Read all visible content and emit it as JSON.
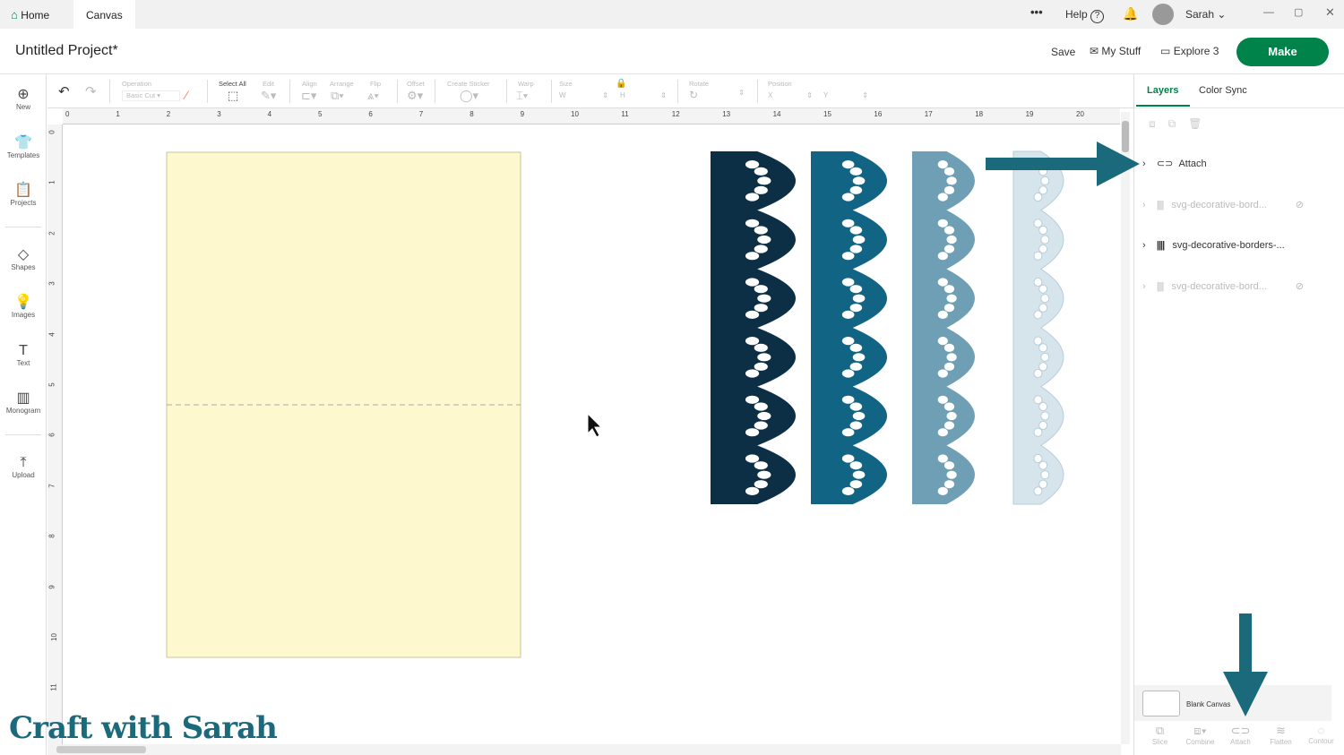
{
  "tabs": [
    {
      "label": "Home",
      "active": false
    },
    {
      "label": "Canvas",
      "active": true
    }
  ],
  "topbar": {
    "more": "•••",
    "help": "Help",
    "user": "Sarah"
  },
  "header": {
    "title": "Untitled Project*",
    "save": "Save",
    "my_stuff": "My Stuff",
    "explore": "Explore 3",
    "make": "Make"
  },
  "sidebar": [
    {
      "label": "New",
      "icon": "⊕"
    },
    {
      "label": "Templates",
      "icon": "👕"
    },
    {
      "label": "Projects",
      "icon": "📋"
    },
    {
      "label": "Shapes",
      "icon": "◇"
    },
    {
      "label": "Images",
      "icon": "💡"
    },
    {
      "label": "Text",
      "icon": "T"
    },
    {
      "label": "Monogram",
      "icon": "▥"
    },
    {
      "label": "Upload",
      "icon": "⤒"
    }
  ],
  "toolbar": {
    "operation": "Operation",
    "operation_value": "Basic Cut",
    "select_all": "Select All",
    "edit": "Edit",
    "align": "Align",
    "arrange": "Arrange",
    "flip": "Flip",
    "offset": "Offset",
    "create_sticker": "Create Sticker",
    "warp": "Warp",
    "size": "Size",
    "w": "W",
    "h": "H",
    "rotate": "Rotate",
    "position": "Position",
    "x": "X",
    "y": "Y"
  },
  "ruler_top": [
    "0",
    "1",
    "2",
    "3",
    "4",
    "5",
    "6",
    "7",
    "8",
    "9",
    "10",
    "11",
    "12",
    "13",
    "14",
    "15",
    "16",
    "17",
    "18",
    "19",
    "20"
  ],
  "ruler_left": [
    "0",
    "1",
    "2",
    "3",
    "4",
    "5",
    "6",
    "7",
    "8",
    "9",
    "10",
    "11"
  ],
  "panel": {
    "tabs": [
      "Layers",
      "Color Sync"
    ],
    "layers": [
      {
        "name": "Attach",
        "icon": "attach-icon",
        "hidden": false,
        "group": true
      },
      {
        "name": "svg-decorative-bord...",
        "hidden": true
      },
      {
        "name": "svg-decorative-borders-...",
        "hidden": false
      },
      {
        "name": "svg-decorative-bord...",
        "hidden": true
      }
    ],
    "blank_canvas": "Blank Canvas",
    "actions": [
      "Slice",
      "Combine",
      "Attach",
      "Flatten",
      "Contour"
    ]
  },
  "colors": {
    "brand": "#00834a",
    "card": "#fef8cf",
    "border1": "#0c2f45",
    "border2": "#126485",
    "border3": "#6f9fb5",
    "border4": "#d6e4ec",
    "arrow": "#1b6a7b"
  },
  "watermark": "Craft with Sarah"
}
